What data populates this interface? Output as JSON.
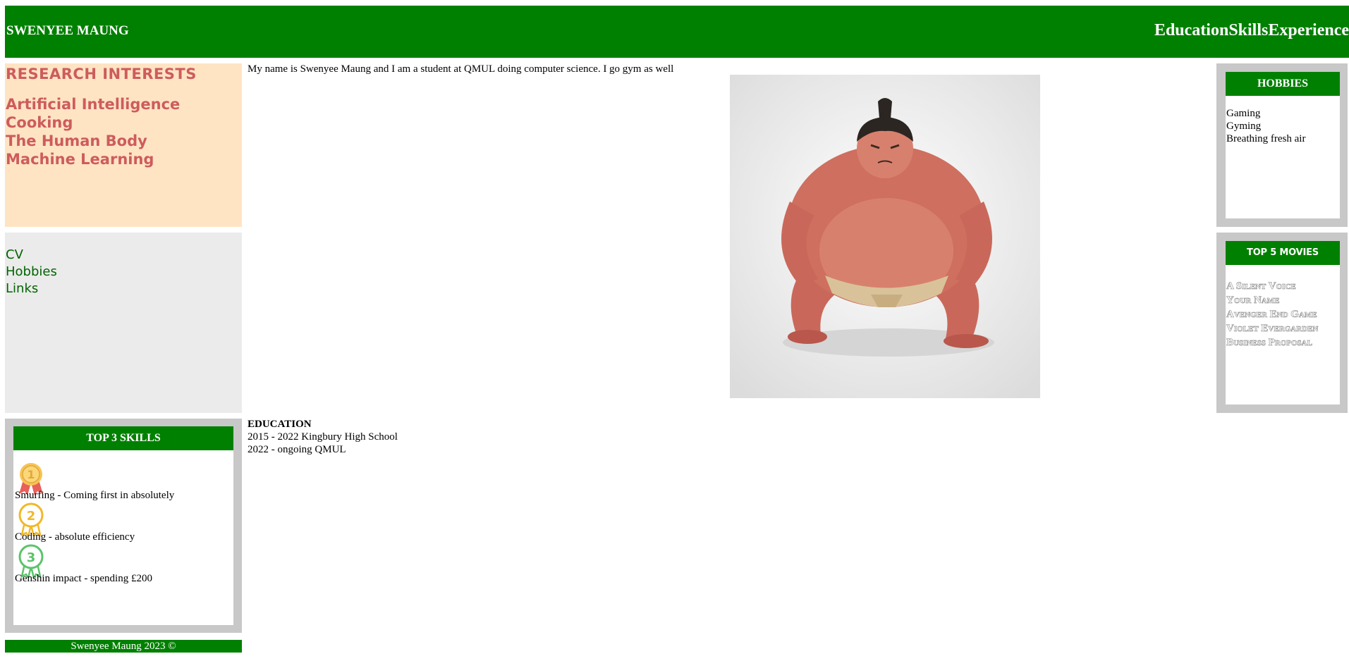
{
  "header": {
    "site_title": "SWENYEE MAUNG",
    "nav": [
      "Education",
      "Skills",
      "Experience"
    ]
  },
  "research": {
    "heading": "RESEARCH INTERESTS",
    "items": [
      "Artificial Intelligence",
      "Cooking",
      "The Human Body",
      "Machine Learning"
    ]
  },
  "links": {
    "items": [
      "CV",
      "Hobbies",
      "Links"
    ]
  },
  "skills": {
    "heading": "TOP 3 SKILLS",
    "items": [
      {
        "text": "Smurfing - Coming first in absolutely",
        "medal": "1"
      },
      {
        "text": "Coding - absolute efficiency",
        "medal": "2"
      },
      {
        "text": "Genshin impact - spending £200",
        "medal": "3"
      }
    ]
  },
  "footer": {
    "text": "Swenyee Maung 2023 ©"
  },
  "intro": {
    "text": "My name is Swenyee Maung and I am a student at QMUL doing computer science. I go gym as well"
  },
  "education": {
    "title": "EDUCATION",
    "entries": [
      "2015 - 2022 Kingbury High School",
      "2022 - ongoing QMUL"
    ]
  },
  "hobbies": {
    "heading": "HOBBIES",
    "items": [
      "Gaming",
      "Gyming",
      "Breathing fresh air"
    ]
  },
  "movies": {
    "heading": "TOP 5 MOVIES",
    "items": [
      "A Silent Voice",
      "Your Name",
      "Avenger End Game",
      "Violet Evergarden",
      "Business Proposal"
    ]
  },
  "colors": {
    "header_green": "#008000",
    "research_bg": "#ffe4c4",
    "research_text": "#cd5c5c",
    "panel_gray": "#c8c8c8",
    "links_bg": "#ebebeb"
  },
  "icons": {
    "hero_image": "sumo-wrestler-illustration",
    "medal_1": "gold-medal-icon",
    "medal_2": "silver-medal-icon",
    "medal_3": "bronze-medal-icon"
  }
}
